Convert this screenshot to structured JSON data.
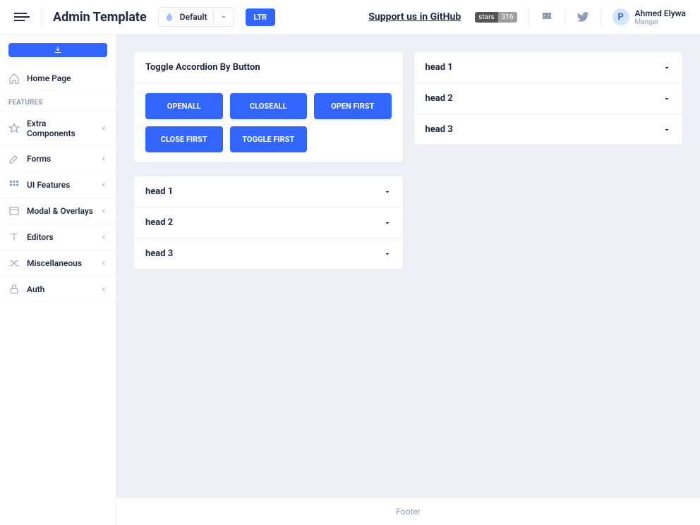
{
  "header": {
    "brand": "Admin Template",
    "theme_label": "Default",
    "ltr_label": "LTR",
    "github_text": "Support us in GitHub",
    "stars_label": "stars",
    "stars_count": "316",
    "user_name": "Ahmed Elywa",
    "user_role": "Manger",
    "avatar_letter": "P"
  },
  "sidebar": {
    "home_label": "Home Page",
    "section_label": "FEATURES",
    "items": [
      {
        "label": "Extra Components"
      },
      {
        "label": "Forms"
      },
      {
        "label": "UI Features"
      },
      {
        "label": "Modal & Overlays"
      },
      {
        "label": "Editors"
      },
      {
        "label": "Miscellaneous"
      },
      {
        "label": "Auth"
      }
    ]
  },
  "main": {
    "toggle_card_title": "Toggle Accordion By Button",
    "buttons": {
      "openall": "OpenAll",
      "closeall": "CloseAll",
      "openfirst": "Open First",
      "closefirst": "Close First",
      "togglefirst": "Toggle First"
    },
    "accordion_left": [
      {
        "label": "head 1"
      },
      {
        "label": "head 2"
      },
      {
        "label": "head 3"
      }
    ],
    "accordion_right": [
      {
        "label": "head 1"
      },
      {
        "label": "head 2"
      },
      {
        "label": "head 3"
      }
    ]
  },
  "footer": {
    "text": "Footer"
  }
}
